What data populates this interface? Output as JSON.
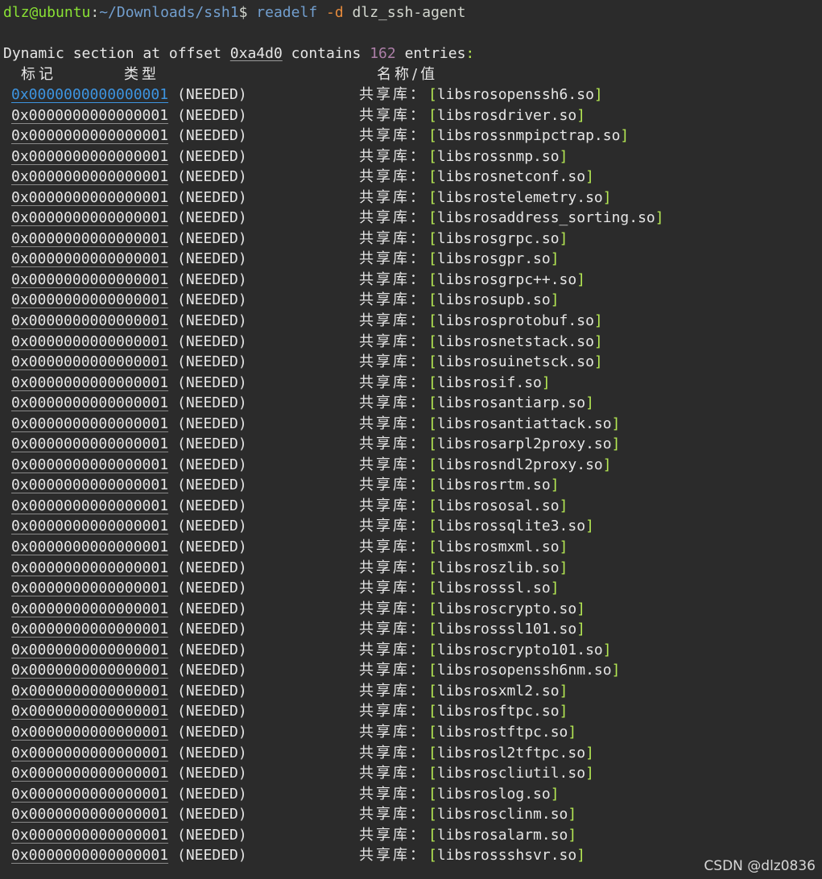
{
  "colors": {
    "background": "#2b2b2b",
    "user_host": "#8ae234",
    "path": "#729fcf",
    "option": "#e58a3c",
    "number": "#ad7fa8",
    "bracket": "#b5e853",
    "link": "#3d94e0"
  },
  "prompt": {
    "user_host": "dlz@ubuntu",
    "separator": ":",
    "path": "~/Downloads/ssh1",
    "symbol": "$",
    "command": "readelf",
    "option": "-d",
    "argument": "dlz_ssh-agent"
  },
  "summary": {
    "prefix": "Dynamic section at offset",
    "offset": "0xa4d0",
    "mid": "contains",
    "count": "162",
    "suffix": "entries",
    "colon": ":"
  },
  "columns": {
    "tag": "标记",
    "type": "类型",
    "name_value": "名称/值"
  },
  "entries": [
    {
      "tag": "0x0000000000000001",
      "type": "(NEEDED)",
      "label": "共享库：",
      "value": "libsrosopenssh6.so"
    },
    {
      "tag": "0x0000000000000001",
      "type": "(NEEDED)",
      "label": "共享库：",
      "value": "libsrosdriver.so"
    },
    {
      "tag": "0x0000000000000001",
      "type": "(NEEDED)",
      "label": "共享库：",
      "value": "libsrossnmpipctrap.so"
    },
    {
      "tag": "0x0000000000000001",
      "type": "(NEEDED)",
      "label": "共享库：",
      "value": "libsrossnmp.so"
    },
    {
      "tag": "0x0000000000000001",
      "type": "(NEEDED)",
      "label": "共享库：",
      "value": "libsrosnetconf.so"
    },
    {
      "tag": "0x0000000000000001",
      "type": "(NEEDED)",
      "label": "共享库：",
      "value": "libsrostelemetry.so"
    },
    {
      "tag": "0x0000000000000001",
      "type": "(NEEDED)",
      "label": "共享库：",
      "value": "libsrosaddress_sorting.so"
    },
    {
      "tag": "0x0000000000000001",
      "type": "(NEEDED)",
      "label": "共享库：",
      "value": "libsrosgrpc.so"
    },
    {
      "tag": "0x0000000000000001",
      "type": "(NEEDED)",
      "label": "共享库：",
      "value": "libsrosgpr.so"
    },
    {
      "tag": "0x0000000000000001",
      "type": "(NEEDED)",
      "label": "共享库：",
      "value": "libsrosgrpc++.so"
    },
    {
      "tag": "0x0000000000000001",
      "type": "(NEEDED)",
      "label": "共享库：",
      "value": "libsrosupb.so"
    },
    {
      "tag": "0x0000000000000001",
      "type": "(NEEDED)",
      "label": "共享库：",
      "value": "libsrosprotobuf.so"
    },
    {
      "tag": "0x0000000000000001",
      "type": "(NEEDED)",
      "label": "共享库：",
      "value": "libsrosnetstack.so"
    },
    {
      "tag": "0x0000000000000001",
      "type": "(NEEDED)",
      "label": "共享库：",
      "value": "libsrosuinetsck.so"
    },
    {
      "tag": "0x0000000000000001",
      "type": "(NEEDED)",
      "label": "共享库：",
      "value": "libsrosif.so"
    },
    {
      "tag": "0x0000000000000001",
      "type": "(NEEDED)",
      "label": "共享库：",
      "value": "libsrosantiarp.so"
    },
    {
      "tag": "0x0000000000000001",
      "type": "(NEEDED)",
      "label": "共享库：",
      "value": "libsrosantiattack.so"
    },
    {
      "tag": "0x0000000000000001",
      "type": "(NEEDED)",
      "label": "共享库：",
      "value": "libsrosarpl2proxy.so"
    },
    {
      "tag": "0x0000000000000001",
      "type": "(NEEDED)",
      "label": "共享库：",
      "value": "libsrosndl2proxy.so"
    },
    {
      "tag": "0x0000000000000001",
      "type": "(NEEDED)",
      "label": "共享库：",
      "value": "libsrosrtm.so"
    },
    {
      "tag": "0x0000000000000001",
      "type": "(NEEDED)",
      "label": "共享库：",
      "value": "libsrososal.so"
    },
    {
      "tag": "0x0000000000000001",
      "type": "(NEEDED)",
      "label": "共享库：",
      "value": "libsrossqlite3.so"
    },
    {
      "tag": "0x0000000000000001",
      "type": "(NEEDED)",
      "label": "共享库：",
      "value": "libsrosmxml.so"
    },
    {
      "tag": "0x0000000000000001",
      "type": "(NEEDED)",
      "label": "共享库：",
      "value": "libsroszlib.so"
    },
    {
      "tag": "0x0000000000000001",
      "type": "(NEEDED)",
      "label": "共享库：",
      "value": "libsrosssl.so"
    },
    {
      "tag": "0x0000000000000001",
      "type": "(NEEDED)",
      "label": "共享库：",
      "value": "libsroscrypto.so"
    },
    {
      "tag": "0x0000000000000001",
      "type": "(NEEDED)",
      "label": "共享库：",
      "value": "libsrosssl101.so"
    },
    {
      "tag": "0x0000000000000001",
      "type": "(NEEDED)",
      "label": "共享库：",
      "value": "libsroscrypto101.so"
    },
    {
      "tag": "0x0000000000000001",
      "type": "(NEEDED)",
      "label": "共享库：",
      "value": "libsrosopenssh6nm.so"
    },
    {
      "tag": "0x0000000000000001",
      "type": "(NEEDED)",
      "label": "共享库：",
      "value": "libsrosxml2.so"
    },
    {
      "tag": "0x0000000000000001",
      "type": "(NEEDED)",
      "label": "共享库：",
      "value": "libsrosftpc.so"
    },
    {
      "tag": "0x0000000000000001",
      "type": "(NEEDED)",
      "label": "共享库：",
      "value": "libsrostftpc.so"
    },
    {
      "tag": "0x0000000000000001",
      "type": "(NEEDED)",
      "label": "共享库：",
      "value": "libsrosl2tftpc.so"
    },
    {
      "tag": "0x0000000000000001",
      "type": "(NEEDED)",
      "label": "共享库：",
      "value": "libsroscliutil.so"
    },
    {
      "tag": "0x0000000000000001",
      "type": "(NEEDED)",
      "label": "共享库：",
      "value": "libsroslog.so"
    },
    {
      "tag": "0x0000000000000001",
      "type": "(NEEDED)",
      "label": "共享库：",
      "value": "libsrosclinm.so"
    },
    {
      "tag": "0x0000000000000001",
      "type": "(NEEDED)",
      "label": "共享库：",
      "value": "libsrosalarm.so"
    },
    {
      "tag": "0x0000000000000001",
      "type": "(NEEDED)",
      "label": "共享库：",
      "value": "libsrossshsvr.so"
    }
  ],
  "watermark": "CSDN @dlz0836"
}
